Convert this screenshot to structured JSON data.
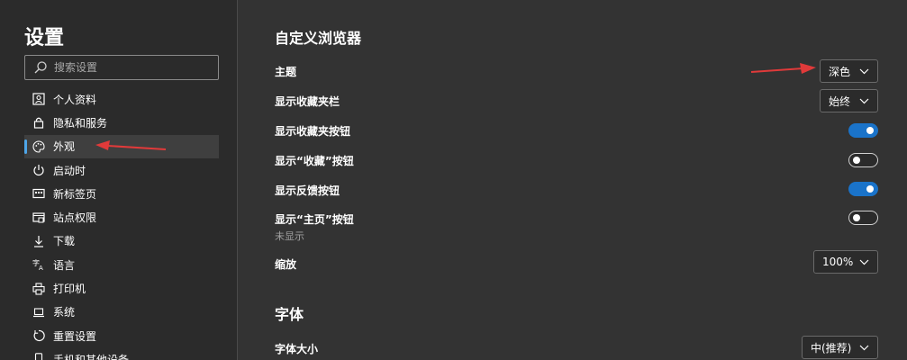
{
  "sidebar": {
    "title": "设置",
    "search_placeholder": "搜索设置",
    "items": [
      {
        "label": "个人资料",
        "icon": "profile-icon"
      },
      {
        "label": "隐私和服务",
        "icon": "lock-icon"
      },
      {
        "label": "外观",
        "icon": "palette-icon"
      },
      {
        "label": "启动时",
        "icon": "power-icon"
      },
      {
        "label": "新标签页",
        "icon": "new-tab-icon"
      },
      {
        "label": "站点权限",
        "icon": "site-permissions-icon"
      },
      {
        "label": "下载",
        "icon": "download-icon"
      },
      {
        "label": "语言",
        "icon": "language-icon"
      },
      {
        "label": "打印机",
        "icon": "printer-icon"
      },
      {
        "label": "系统",
        "icon": "laptop-icon"
      },
      {
        "label": "重置设置",
        "icon": "reset-icon"
      },
      {
        "label": "手机和其他设备",
        "icon": "phone-icon"
      }
    ]
  },
  "main": {
    "customize": {
      "title": "自定义浏览器",
      "theme": {
        "label": "主题",
        "value": "深色"
      },
      "favorites_bar": {
        "label": "显示收藏夹栏",
        "value": "始终"
      },
      "favorites_button": {
        "label": "显示收藏夹按钮",
        "on": true
      },
      "collections_button": {
        "label": "显示“收藏”按钮",
        "on": false
      },
      "feedback_button": {
        "label": "显示反馈按钮",
        "on": true
      },
      "home_button": {
        "label": "显示“主页”按钮",
        "on": false,
        "sub": "未显示"
      },
      "zoom": {
        "label": "缩放",
        "value": "100%"
      }
    },
    "fonts": {
      "title": "字体",
      "font_size": {
        "label": "字体大小",
        "value": "中(推荐)"
      }
    }
  },
  "colors": {
    "accent": "#1a73c9",
    "annotation_arrow": "#e03a3a"
  }
}
